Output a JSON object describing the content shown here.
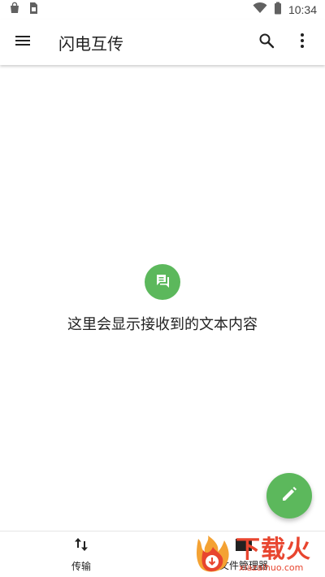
{
  "status_bar": {
    "time": "10:34",
    "icons": [
      "bag-icon",
      "sim-icon",
      "wifi-icon",
      "battery-icon"
    ]
  },
  "app_bar": {
    "title": "闪电互传",
    "icons": [
      "menu-icon",
      "search-icon",
      "more-vert-icon"
    ]
  },
  "empty_state": {
    "icon": "chat-icon",
    "message": "这里会显示接收到的文本内容"
  },
  "fab": {
    "icon": "edit-icon"
  },
  "bottom_nav": {
    "items": [
      {
        "label": "传输",
        "icon": "swap-vert-icon"
      },
      {
        "label": "文件管理器",
        "icon": "folder-icon"
      }
    ]
  },
  "watermark": {
    "title": "下载火",
    "subtitle": "xiazaihuo.com"
  },
  "colors": {
    "accent_green": "#5cb85c",
    "watermark_red": "#e8452f"
  }
}
